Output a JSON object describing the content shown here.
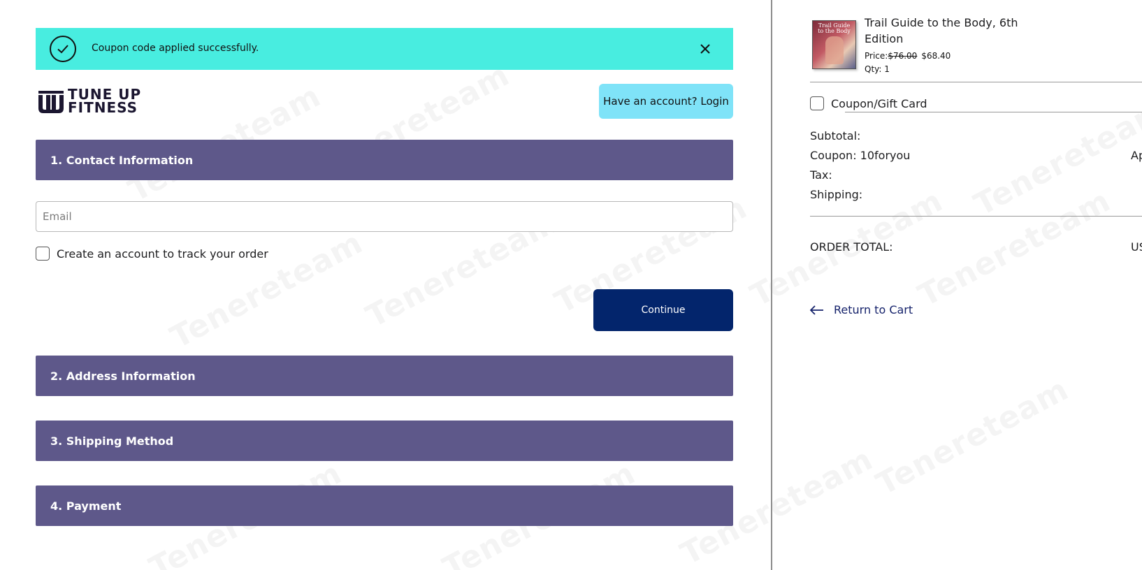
{
  "alert": {
    "message": "Coupon code applied successfully.",
    "icon": "check-circle-icon",
    "close_icon": "close-icon",
    "bg_color": "#48ede0"
  },
  "header": {
    "logo_line1": "TUNE UP",
    "logo_line2": "FITNESS",
    "login_label": "Have an account? Login"
  },
  "contact": {
    "heading": "1. Contact Information",
    "email_placeholder": "Email",
    "email_value": "",
    "create_account_label": "Create an account to track your order",
    "create_account_checked": false,
    "continue_label": "Continue"
  },
  "sections": {
    "address": "2. Address Information",
    "shipping": "3. Shipping Method",
    "payment": "4. Payment"
  },
  "cart": {
    "product_title": "Trail Guide to the Body, 6th Edition",
    "cover_text": "Trail Guide to the Body",
    "price_label": "Price:",
    "old_price": "$76.00",
    "new_price": "$68.40",
    "qty_label": "Qty: 1",
    "coupon_toggle_label": "Coupon/Gift Card",
    "subtotal_label": "Subtotal:",
    "coupon_label": "Coupon: 10foryou",
    "coupon_value_partial": "Ap",
    "tax_label": "Tax:",
    "shipping_label": "Shipping:",
    "order_total_label": "ORDER TOTAL:",
    "order_total_value_partial": "US",
    "return_label": "Return to Cart"
  },
  "colors": {
    "section_header": "#5e588a",
    "primary_button": "#03256c",
    "login_button": "#7fe3f8",
    "link": "#15226b"
  },
  "watermark": "Tenereteam"
}
